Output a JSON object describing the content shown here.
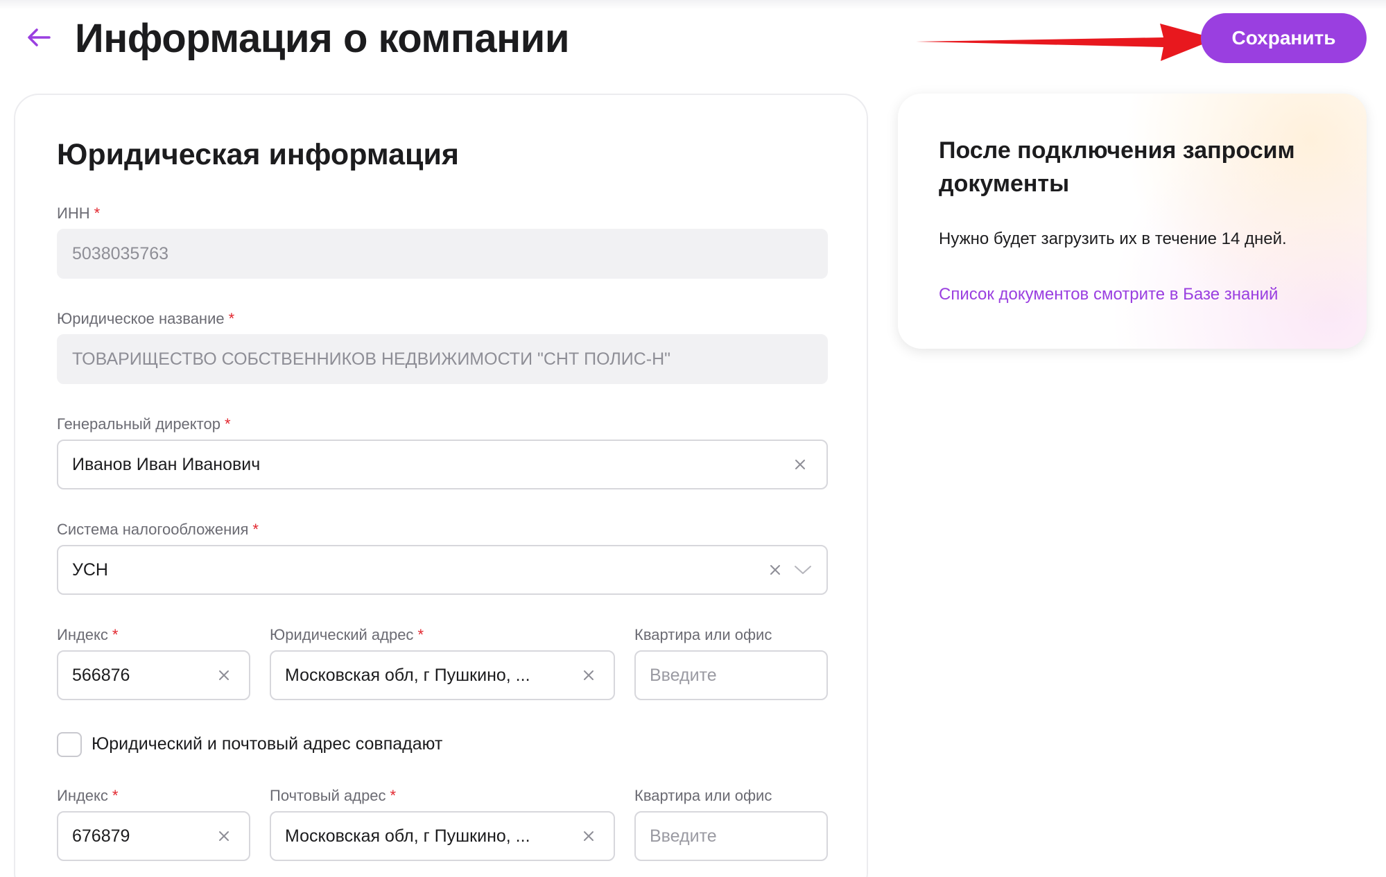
{
  "header": {
    "title": "Информация о компании",
    "save_label": "Сохранить",
    "accent_color": "#9a3fe0"
  },
  "form": {
    "section_title": "Юридическая информация",
    "inn": {
      "label": "ИНН",
      "required_mark": "*",
      "value": "5038035763"
    },
    "legal_name": {
      "label": "Юридическое название",
      "required_mark": "*",
      "value": "ТОВАРИЩЕСТВО СОБСТВЕННИКОВ НЕДВИЖИМОСТИ \"СНТ ПОЛИС-Н\""
    },
    "director": {
      "label": "Генеральный директор",
      "required_mark": "*",
      "value": "Иванов Иван Иванович"
    },
    "tax_system": {
      "label": "Система налогообложения",
      "required_mark": "*",
      "value": "УСН"
    },
    "legal_index": {
      "label": "Индекс",
      "required_mark": "*",
      "value": "566876"
    },
    "legal_address": {
      "label": "Юридический адрес",
      "required_mark": "*",
      "value": "Московская обл, г Пушкино, ..."
    },
    "legal_office": {
      "label": "Квартира или офис",
      "placeholder": "Введите"
    },
    "same_address": {
      "label": "Юридический и почтовый адрес совпадают",
      "checked": false
    },
    "postal_index": {
      "label": "Индекс",
      "required_mark": "*",
      "value": "676879"
    },
    "postal_address": {
      "label": "Почтовый адрес",
      "required_mark": "*",
      "value": "Московская обл, г Пушкино, ..."
    },
    "postal_office": {
      "label": "Квартира или офис",
      "placeholder": "Введите"
    }
  },
  "info_card": {
    "title": "После подключения запросим документы",
    "text": "Нужно будет загрузить их в течение 14 дней.",
    "link": "Список документов смотрите в Базе знаний"
  },
  "icons": {
    "back": "arrow-left-icon",
    "clear": "close-icon",
    "dropdown": "chevron-down-icon",
    "annotation": "red-arrow-icon"
  }
}
